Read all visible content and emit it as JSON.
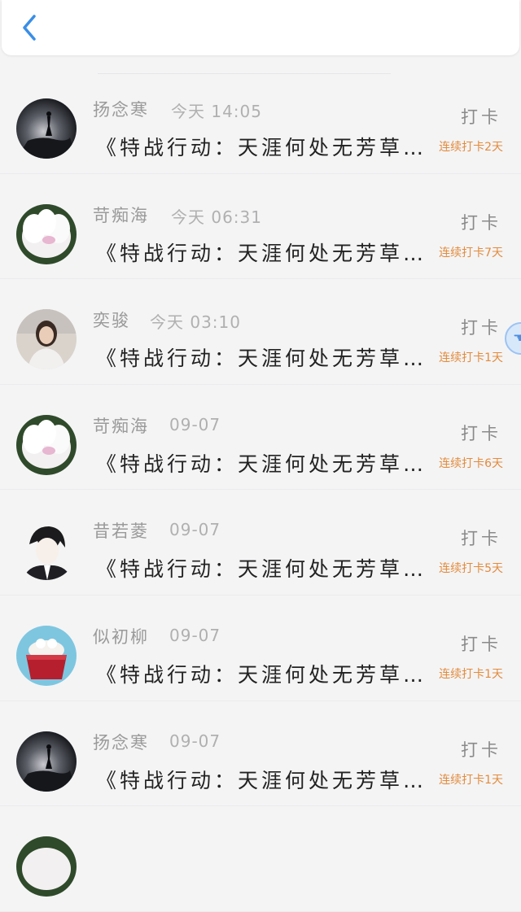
{
  "header": {
    "back_icon": "chevron-left-icon",
    "accent": "#3a8ee6"
  },
  "rows": [
    {
      "name": "扬念寒",
      "time": "今天 14:05",
      "action": "打卡",
      "message": "《特战行动：天涯何处无芳草…",
      "streak": "连续打卡2天",
      "avatar": "dark-figure"
    },
    {
      "name": "苛痴海",
      "time": "今天 06:31",
      "action": "打卡",
      "message": "《特战行动：天涯何处无芳草…",
      "streak": "连续打卡7天",
      "avatar": "white-flower"
    },
    {
      "name": "奕骏",
      "time": "今天 03:10",
      "action": "打卡",
      "message": "《特战行动：天涯何处无芳草…",
      "streak": "连续打卡1天",
      "avatar": "girl-photo"
    },
    {
      "name": "苛痴海",
      "time": "09-07",
      "action": "打卡",
      "message": "《特战行动：天涯何处无芳草…",
      "streak": "连续打卡6天",
      "avatar": "white-flower"
    },
    {
      "name": "昔若菱",
      "time": "09-07",
      "action": "打卡",
      "message": "《特战行动：天涯何处无芳草…",
      "streak": "连续打卡5天",
      "avatar": "anime-boy"
    },
    {
      "name": "似初柳",
      "time": "09-07",
      "action": "打卡",
      "message": "《特战行动：天涯何处无芳草…",
      "streak": "连续打卡1天",
      "avatar": "cupcake"
    },
    {
      "name": "扬念寒",
      "time": "09-07",
      "action": "打卡",
      "message": "《特战行动：天涯何处无芳草…",
      "streak": "连续打卡1天",
      "avatar": "dark-figure"
    }
  ],
  "colors": {
    "streak": "#e38b3c",
    "name": "#9a9a9a",
    "message": "#222222"
  }
}
